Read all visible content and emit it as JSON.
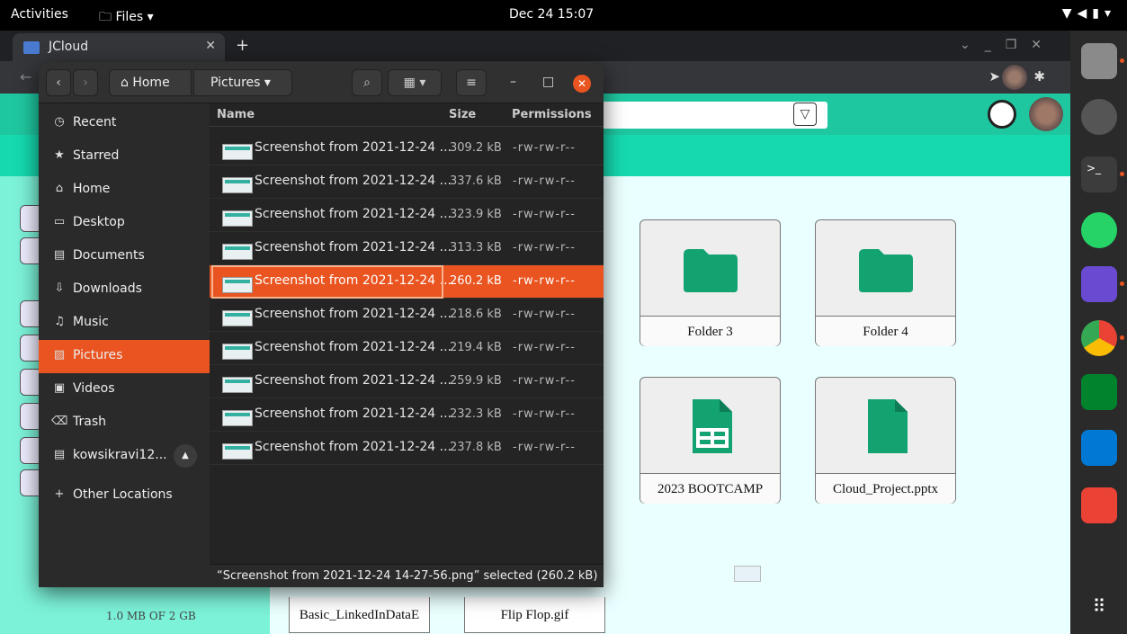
{
  "topbar": {
    "activities": "Activities",
    "files": "Files",
    "clock": "Dec 24  15:07"
  },
  "browser": {
    "tab_title": "JCloud"
  },
  "web": {
    "storage_text": "1.0 MB OF 2 GB",
    "tiles": [
      {
        "label": "Folder 3",
        "icon": "folder-icon"
      },
      {
        "label": "Folder 4",
        "icon": "folder-icon"
      },
      {
        "label": "2023 BOOTCAMP",
        "icon": "spreadsheet-icon"
      },
      {
        "label": "Cloud_Project.pptx",
        "icon": "document-icon"
      }
    ],
    "bottom_files": [
      "Basic_LinkedInDataE",
      "Flip Flop.gif"
    ]
  },
  "files_window": {
    "path": {
      "home": "Home",
      "current": "Pictures"
    },
    "sidebar": [
      {
        "label": "Recent",
        "icon": "clock-icon"
      },
      {
        "label": "Starred",
        "icon": "star-icon"
      },
      {
        "label": "Home",
        "icon": "home-icon"
      },
      {
        "label": "Desktop",
        "icon": "desktop-icon"
      },
      {
        "label": "Documents",
        "icon": "document-icon"
      },
      {
        "label": "Downloads",
        "icon": "download-icon"
      },
      {
        "label": "Music",
        "icon": "music-icon"
      },
      {
        "label": "Pictures",
        "icon": "picture-icon",
        "active": true
      },
      {
        "label": "Videos",
        "icon": "video-icon"
      },
      {
        "label": "Trash",
        "icon": "trash-icon"
      },
      {
        "label": "kowsikravi12...",
        "icon": "drive-icon"
      },
      {
        "label": "Other Locations",
        "icon": "plus-icon"
      }
    ],
    "columns": {
      "name": "Name",
      "size": "Size",
      "permissions": "Permissions"
    },
    "rows": [
      {
        "name": "Screenshot from 2021-12-24 ...",
        "size": "309.2 kB",
        "perm": "-rw-rw-r--"
      },
      {
        "name": "Screenshot from 2021-12-24 ...",
        "size": "337.6 kB",
        "perm": "-rw-rw-r--"
      },
      {
        "name": "Screenshot from 2021-12-24 ...",
        "size": "323.9 kB",
        "perm": "-rw-rw-r--"
      },
      {
        "name": "Screenshot from 2021-12-24 ...",
        "size": "313.3 kB",
        "perm": "-rw-rw-r--"
      },
      {
        "name": "Screenshot from 2021-12-24 ...",
        "size": "260.2 kB",
        "perm": "-rw-rw-r--",
        "selected": true
      },
      {
        "name": "Screenshot from 2021-12-24 ...",
        "size": "218.6 kB",
        "perm": "-rw-rw-r--"
      },
      {
        "name": "Screenshot from 2021-12-24 ...",
        "size": "219.4 kB",
        "perm": "-rw-rw-r--"
      },
      {
        "name": "Screenshot from 2021-12-24 ...",
        "size": "259.9 kB",
        "perm": "-rw-rw-r--"
      },
      {
        "name": "Screenshot from 2021-12-24 ...",
        "size": "232.3 kB",
        "perm": "-rw-rw-r--"
      },
      {
        "name": "Screenshot from 2021-12-24 ...",
        "size": "237.8 kB",
        "perm": "-rw-rw-r--"
      }
    ],
    "status": "“Screenshot from 2021-12-24 14-27-56.png” selected  (260.2 kB)"
  },
  "dock": [
    "files-app-icon",
    "settings-icon",
    "terminal-icon",
    "whatsapp-icon",
    "cube-app-icon",
    "chrome-icon",
    "meet-icon",
    "vscode-icon",
    "gmail-icon",
    "app-grid-icon"
  ],
  "colors": {
    "accent": "#e95420",
    "web_header": "#1fc7a0",
    "web_left": "#7cf2d8",
    "folder_green": "#13a370"
  }
}
